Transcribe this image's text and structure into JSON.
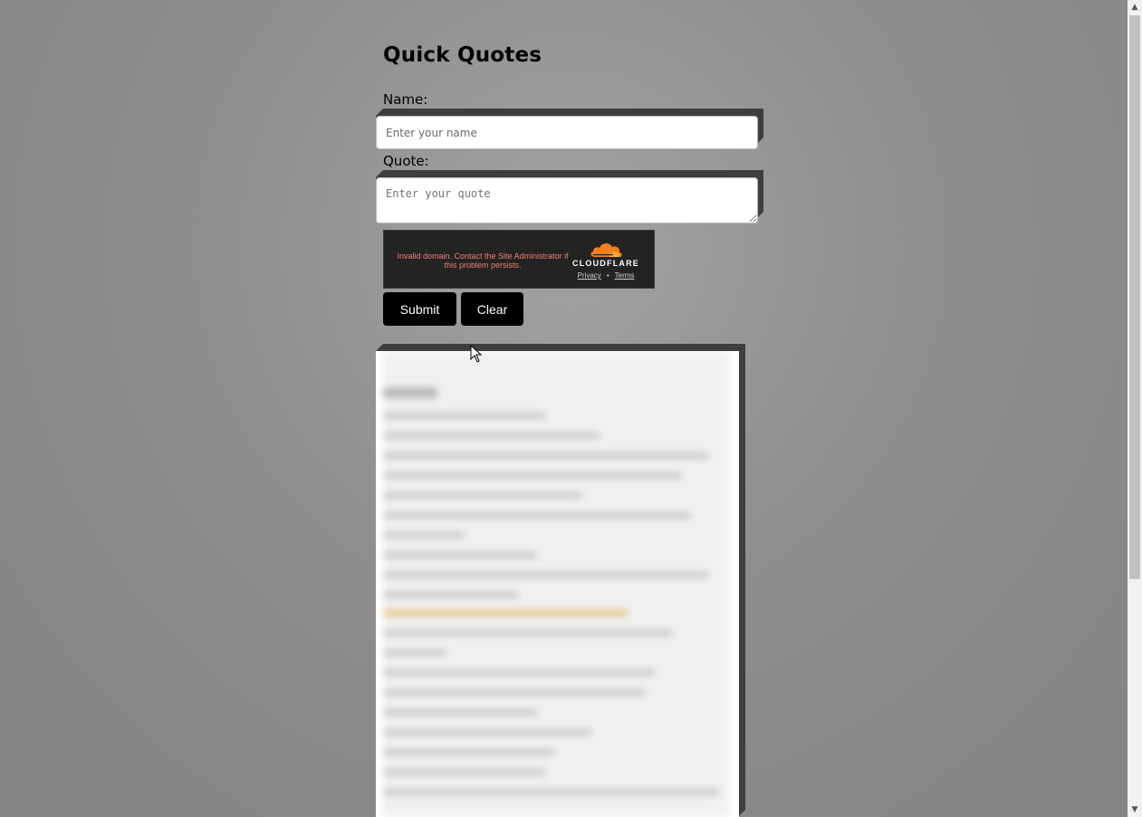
{
  "page": {
    "title": "Quick Quotes"
  },
  "form": {
    "name_label": "Name:",
    "name_placeholder": "Enter your name",
    "name_value": "",
    "quote_label": "Quote:",
    "quote_placeholder": "Enter your quote",
    "quote_value": "",
    "submit_label": "Submit",
    "clear_label": "Clear"
  },
  "turnstile": {
    "message": "Invalid domain. Contact the Site Administrator if this problem persists.",
    "brand": "CLOUDFLARE",
    "privacy_label": "Privacy",
    "separator": "•",
    "terms_label": "Terms",
    "brand_color": "#f38020"
  },
  "quotes_panel": {
    "state": "blurred"
  },
  "colors": {
    "background": "#908e8f",
    "button_bg": "#000000",
    "shadow": "#3e3e3e",
    "error_text": "#f08070"
  },
  "scrollbar": {
    "up_icon": "chevron-up-icon",
    "down_icon": "chevron-down-icon"
  }
}
